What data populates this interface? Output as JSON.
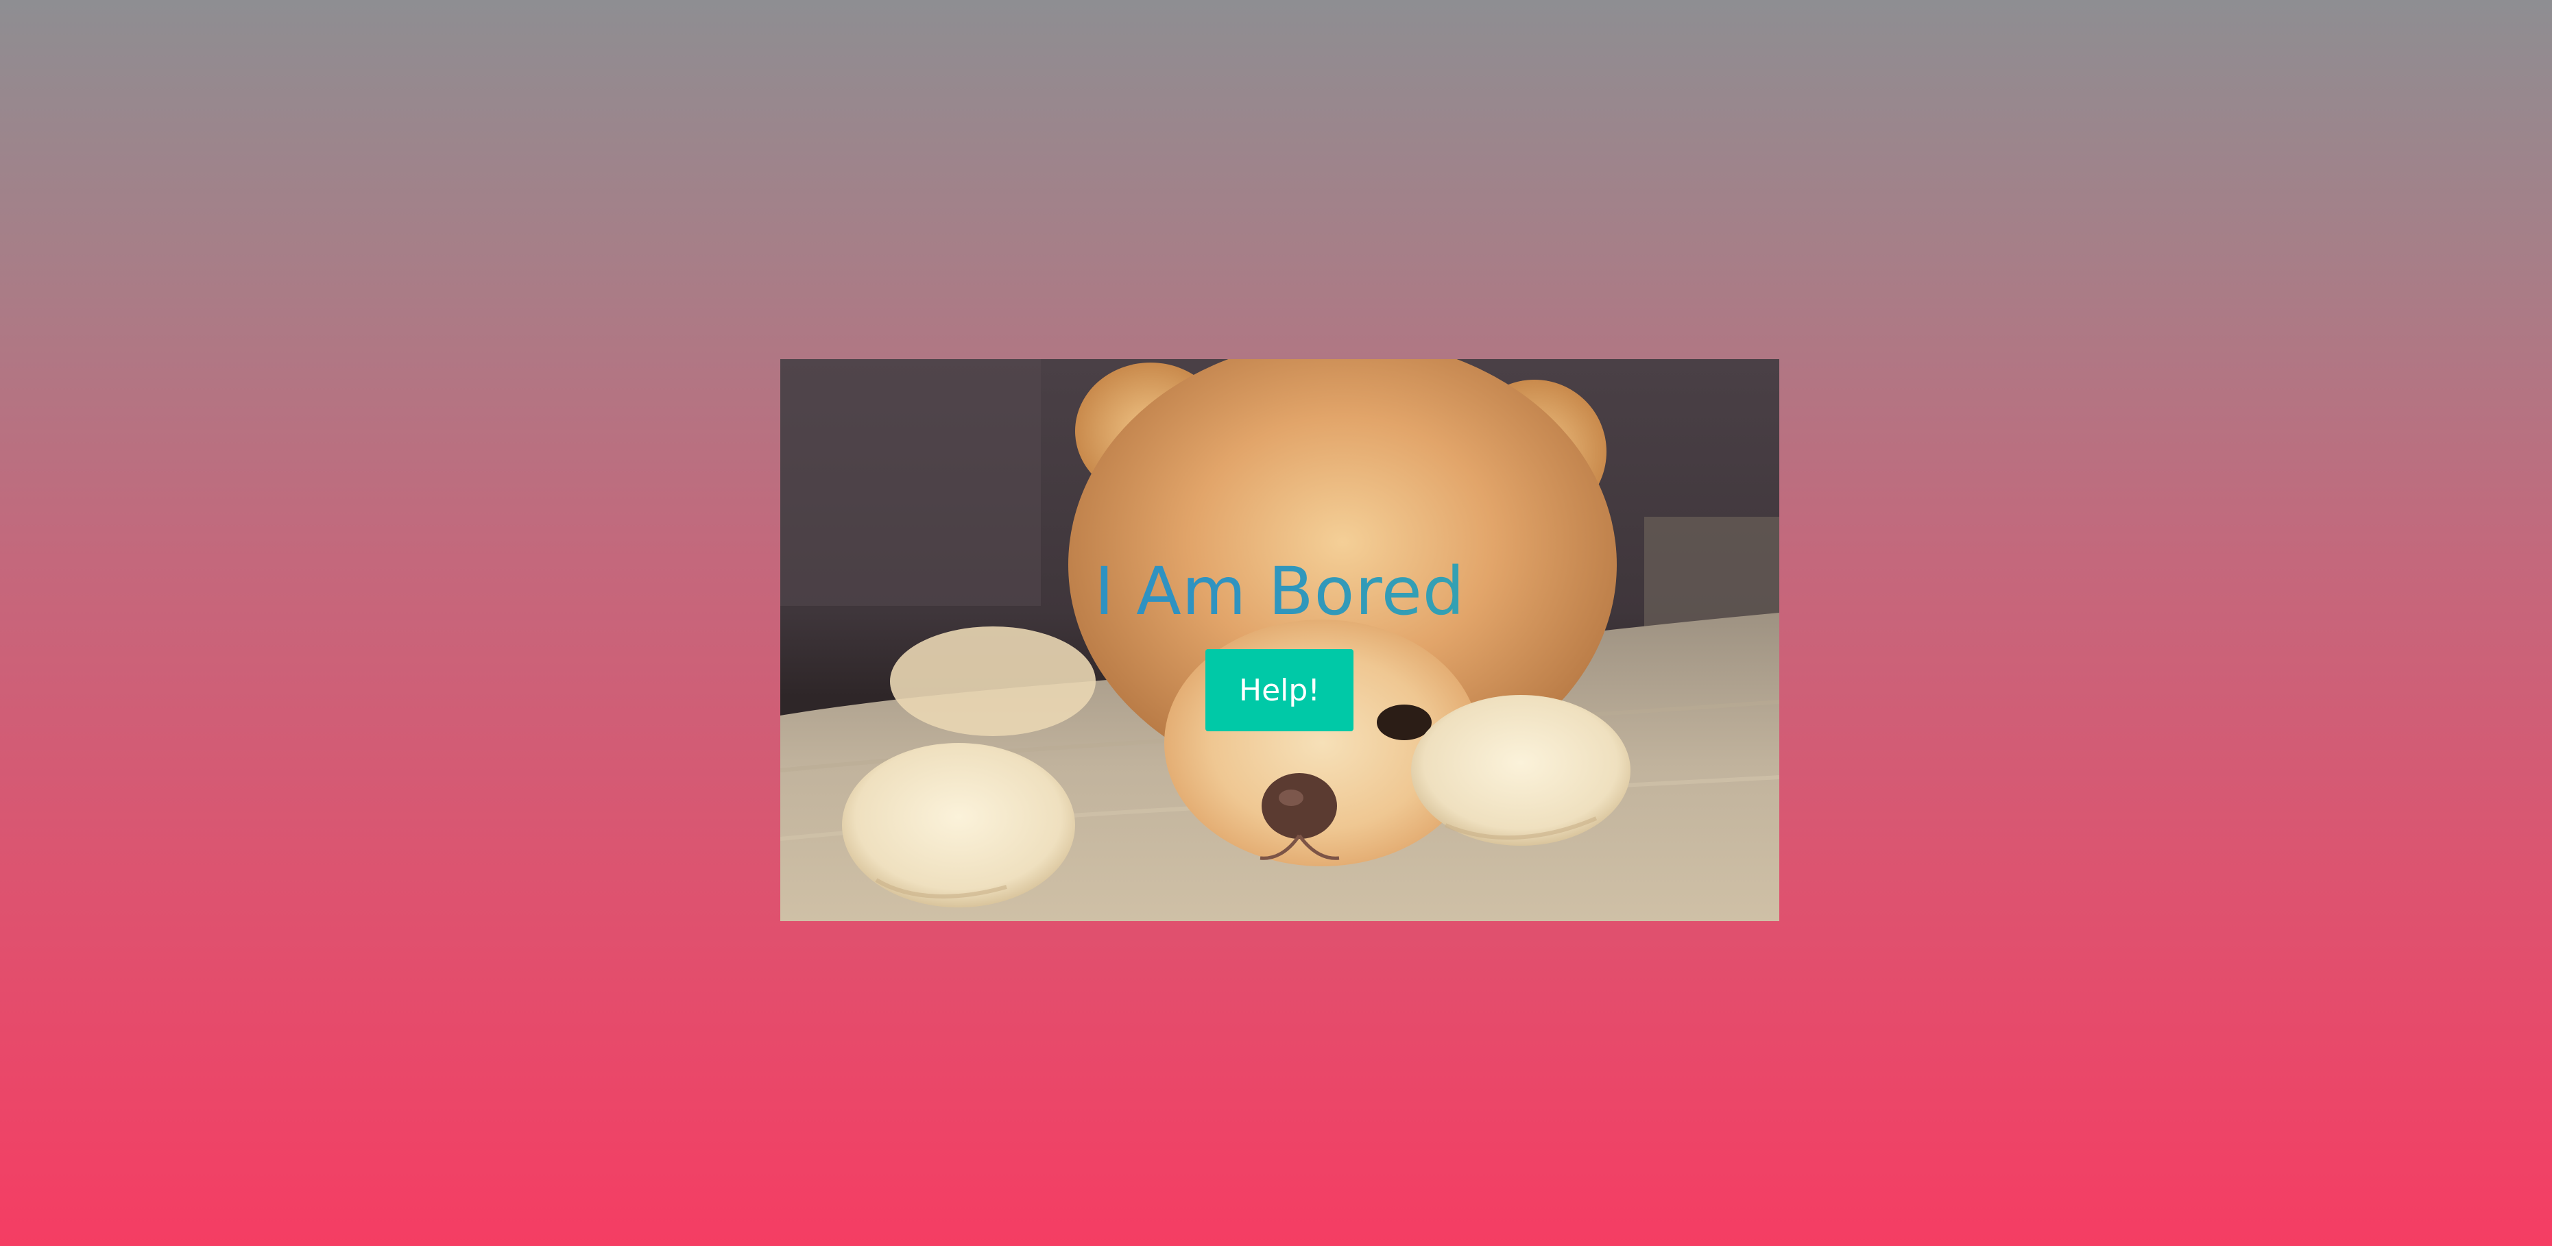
{
  "hero": {
    "image_alt": "puppy-photo",
    "title": "I Am Bored",
    "button_label": "Help!"
  },
  "colors": {
    "background_top": "#8e8e92",
    "background_bottom": "#f53d63",
    "button": "#00c9a7",
    "title_start": "#2d8fc8",
    "title_end": "#3ab3a0"
  }
}
